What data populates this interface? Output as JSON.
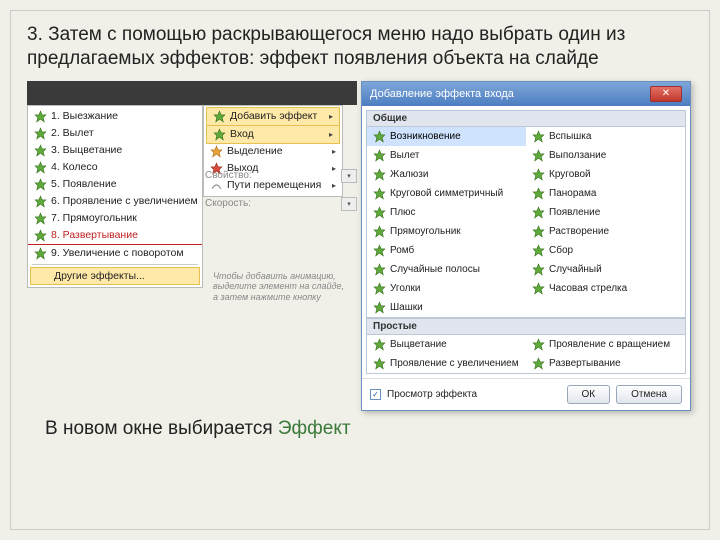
{
  "instruction": "3. Затем с помощью раскрывающегося меню надо выбрать один из предлагаемых эффектов: эффект появления объекта на слайде",
  "note_prefix": "В новом окне выбирается ",
  "note_effect": "Эффект",
  "add_effect_label": "Добавить эффект",
  "submenu": {
    "items": [
      {
        "label": "Вход",
        "icon": "green"
      },
      {
        "label": "Выделение",
        "icon": "orange"
      },
      {
        "label": "Выход",
        "icon": "red"
      },
      {
        "label": "Пути перемещения",
        "icon": "path"
      }
    ]
  },
  "effects_list": [
    "1. Выезжание",
    "2. Вылет",
    "3. Выцветание",
    "4. Колесо",
    "5. Появление",
    "6. Проявление с увеличением",
    "7. Прямоугольник",
    "8. Развертывание",
    "9. Увеличение с поворотом"
  ],
  "other_effects_label": "Другие эффекты...",
  "props": {
    "p1": "Свойство:",
    "p2": "Скорость:"
  },
  "hint": "Чтобы добавить анимацию, выделите элемент на слайде, а затем нажмите кнопку",
  "dialog": {
    "title": "Добавление эффекта входа",
    "section_common": "Общие",
    "common": [
      [
        "Возникновение",
        "Вспышка"
      ],
      [
        "Вылет",
        "Выползание"
      ],
      [
        "Жалюзи",
        "Круговой"
      ],
      [
        "Круговой симметричный",
        "Панорама"
      ],
      [
        "Плюс",
        "Появление"
      ],
      [
        "Прямоугольник",
        "Растворение"
      ],
      [
        "Ромб",
        "Сбор"
      ],
      [
        "Случайные полосы",
        "Случайный"
      ],
      [
        "Уголки",
        "Часовая стрелка"
      ],
      [
        "Шашки",
        ""
      ]
    ],
    "section_simple": "Простые",
    "simple": [
      [
        "Выцветание",
        "Проявление с вращением"
      ],
      [
        "Проявление с увеличением",
        "Развертывание"
      ]
    ],
    "preview_label": "Просмотр эффекта",
    "ok": "ОК",
    "cancel": "Отмена"
  }
}
